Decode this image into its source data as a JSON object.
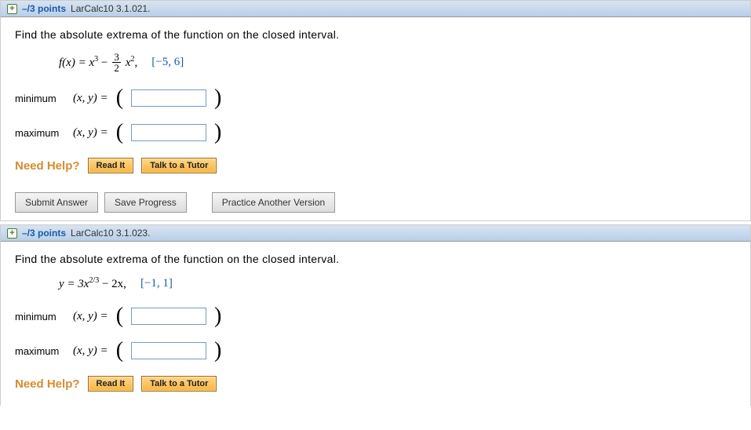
{
  "questions": [
    {
      "points": "–/3 points",
      "reference": "LarCalc10 3.1.021.",
      "prompt": "Find the absolute extrema of the function on the closed interval.",
      "formula_prefix": "f(x) = x",
      "formula_exp1": "3",
      "formula_mid": " − ",
      "frac_num": "3",
      "frac_den": "2",
      "formula_suffix": "x",
      "formula_exp2": "2",
      "formula_comma": ",",
      "interval": "[−5, 6]",
      "rows": [
        {
          "label": "minimum",
          "eq": "(x, y)  ="
        },
        {
          "label": "maximum",
          "eq": "(x, y)  ="
        }
      ],
      "need_help": "Need Help?",
      "read_it": "Read It",
      "talk_tutor": "Talk to a Tutor",
      "submit": "Submit Answer",
      "save": "Save Progress",
      "practice": "Practice Another Version"
    },
    {
      "points": "–/3 points",
      "reference": "LarCalc10 3.1.023.",
      "prompt": "Find the absolute extrema of the function on the closed interval.",
      "formula_prefix": "y = 3x",
      "formula_exp1": "2/3",
      "formula_mid": " − 2x,",
      "interval": "[−1, 1]",
      "rows": [
        {
          "label": "minimum",
          "eq": "(x, y)  ="
        },
        {
          "label": "maximum",
          "eq": "(x, y)  ="
        }
      ],
      "need_help": "Need Help?",
      "read_it": "Read It",
      "talk_tutor": "Talk to a Tutor"
    }
  ]
}
